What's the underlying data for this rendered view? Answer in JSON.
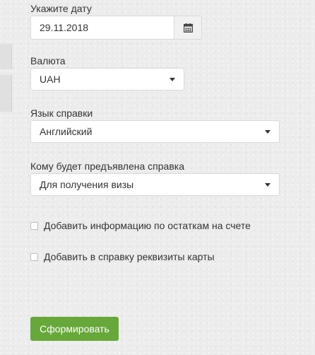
{
  "date": {
    "label": "Укажите дату",
    "value": "29.11.2018"
  },
  "currency": {
    "label": "Валюта",
    "selected": "UAH"
  },
  "language": {
    "label": "Язык справки",
    "selected": "Английский"
  },
  "recipient": {
    "label": "Кому будет предъявлена справка",
    "selected": "Для получения визы"
  },
  "options": {
    "balance_label": "Добавить информацию по остаткам на счете",
    "card_label": "Добавить в справку реквизиты карты"
  },
  "submit_label": "Сформировать",
  "colors": {
    "accent": "#67a83a",
    "background": "#ececec"
  },
  "icons": {
    "calendar": "calendar-icon",
    "dropdown": "chevron-down-icon"
  }
}
